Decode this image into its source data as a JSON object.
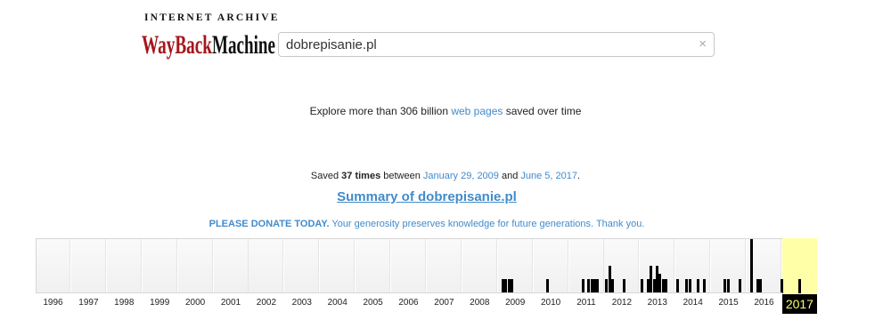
{
  "logo": {
    "top_text": "INTERNET ARCHIVE",
    "wayback": "WayBack",
    "machine": "Machine"
  },
  "search": {
    "value": "dobrepisanie.pl",
    "clear_icon": "×"
  },
  "explore": {
    "before": "Explore more than 306 billion ",
    "link": "web pages",
    "after": " saved over time"
  },
  "saved": {
    "prefix": "Saved ",
    "count": "37 times",
    "between": " between ",
    "first_date": "January 29, 2009",
    "and": " and ",
    "last_date": "June 5, 2017",
    "end": "."
  },
  "summary": {
    "label": "Summary of dobrepisanie.pl"
  },
  "donate": {
    "strong": "PLEASE DONATE TODAY.",
    "rest": " Your generosity preserves knowledge for future generations. Thank you."
  },
  "timeline": {
    "years": [
      "1996",
      "1997",
      "1998",
      "1999",
      "2000",
      "2001",
      "2002",
      "2003",
      "2004",
      "2005",
      "2006",
      "2007",
      "2008",
      "2009",
      "2010",
      "2011",
      "2012",
      "2013",
      "2014",
      "2015",
      "2016",
      "2017"
    ],
    "selected_year": "2017",
    "colors": {
      "selected_bg": "#ffffa8",
      "selected_label_bg": "#000000",
      "selected_label_fg": "#ffff66",
      "bar": "#000000"
    },
    "captures": [
      {
        "year": "2009",
        "month": 1,
        "level": 0.25
      },
      {
        "year": "2009",
        "month": 2,
        "level": 0.25
      },
      {
        "year": "2009",
        "month": 3,
        "level": 0.25
      },
      {
        "year": "2009",
        "month": 4,
        "level": 0.25
      },
      {
        "year": "2010",
        "month": 4,
        "level": 0.25
      },
      {
        "year": "2011",
        "month": 4,
        "level": 0.25
      },
      {
        "year": "2011",
        "month": 6,
        "level": 0.25
      },
      {
        "year": "2011",
        "month": 7,
        "level": 0.25
      },
      {
        "year": "2011",
        "month": 8,
        "level": 0.25
      },
      {
        "year": "2011",
        "month": 9,
        "level": 0.25
      },
      {
        "year": "2012",
        "month": 0,
        "level": 0.25
      },
      {
        "year": "2012",
        "month": 1,
        "level": 0.5
      },
      {
        "year": "2012",
        "month": 2,
        "level": 0.25
      },
      {
        "year": "2012",
        "month": 6,
        "level": 0.25
      },
      {
        "year": "2013",
        "month": 0,
        "level": 0.25
      },
      {
        "year": "2013",
        "month": 2,
        "level": 0.25
      },
      {
        "year": "2013",
        "month": 3,
        "level": 0.5
      },
      {
        "year": "2013",
        "month": 4,
        "level": 0.25
      },
      {
        "year": "2013",
        "month": 5,
        "level": 0.5
      },
      {
        "year": "2013",
        "month": 6,
        "level": 0.35
      },
      {
        "year": "2013",
        "month": 7,
        "level": 0.25
      },
      {
        "year": "2013",
        "month": 8,
        "level": 0.25
      },
      {
        "year": "2014",
        "month": 0,
        "level": 0.25
      },
      {
        "year": "2014",
        "month": 3,
        "level": 0.25
      },
      {
        "year": "2014",
        "month": 4,
        "level": 0.25
      },
      {
        "year": "2014",
        "month": 7,
        "level": 0.25
      },
      {
        "year": "2014",
        "month": 9,
        "level": 0.25
      },
      {
        "year": "2015",
        "month": 4,
        "level": 0.25
      },
      {
        "year": "2015",
        "month": 5,
        "level": 0.25
      },
      {
        "year": "2015",
        "month": 9,
        "level": 0.25
      },
      {
        "year": "2016",
        "month": 1,
        "level": 1.0
      },
      {
        "year": "2016",
        "month": 3,
        "level": 0.25
      },
      {
        "year": "2016",
        "month": 4,
        "level": 0.25
      },
      {
        "year": "2016",
        "month": 11,
        "level": 0.25
      },
      {
        "year": "2017",
        "month": 5,
        "level": 0.25
      }
    ]
  }
}
